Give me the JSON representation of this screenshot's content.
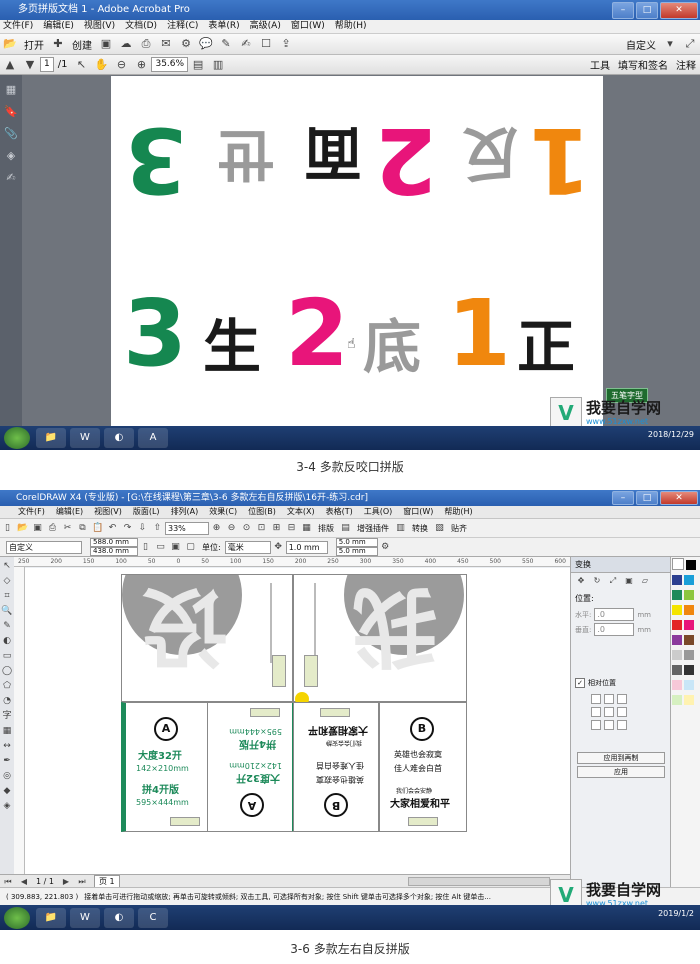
{
  "acrobat": {
    "title": "多页拼版文档 1 - Adobe Acrobat Pro",
    "menu": [
      "文件(F)",
      "编辑(E)",
      "视图(V)",
      "文档(D)",
      "注释(C)",
      "表单(R)",
      "高级(A)",
      "窗口(W)",
      "帮助(H)"
    ],
    "toolbar": {
      "open_label": "打开",
      "create_label": "创建",
      "custom_label": "自定义"
    },
    "nav": {
      "page_current": "1",
      "page_total": "/1",
      "zoom": "35.6%"
    },
    "panels": {
      "tools": "工具",
      "fill_sign": "填写和签名",
      "comment": "注释"
    },
    "page": {
      "top_row": [
        {
          "num": "3",
          "char": "世",
          "num_color": "#158750",
          "char_color": "#9a9a9a"
        },
        {
          "num": "2",
          "char": "面",
          "num_color": "#e8157a",
          "char_color": "#1a1a1a"
        },
        {
          "num": "1",
          "char": "反",
          "num_color": "#f0870e",
          "char_color": "#9a9a9a"
        }
      ],
      "bottom_row": [
        {
          "num": "3",
          "char": "生",
          "num_color": "#158750",
          "char_color": "#1a1a1a"
        },
        {
          "num": "2",
          "char": "底",
          "num_color": "#e8157a",
          "char_color": "#9a9a9a"
        },
        {
          "num": "1",
          "char": "正",
          "num_color": "#f0870e",
          "char_color": "#1a1a1a"
        }
      ]
    },
    "ime": "五笔字型",
    "clock": "2018/12/29"
  },
  "logo": {
    "text": "我要自学网",
    "url": "www.51zxw.net"
  },
  "captions": {
    "first": "3-4 多款反咬口拼版",
    "second": "3-6 多款左右自反拼版"
  },
  "corel": {
    "title": "CorelDRAW X4 (专业版) - [G:\\在线课程\\第三章\\3-6 多款左右自反拼版\\16开-练习.cdr]",
    "menu": [
      "文件(F)",
      "编辑(E)",
      "视图(V)",
      "版面(L)",
      "排列(A)",
      "效果(C)",
      "位图(B)",
      "文本(X)",
      "表格(T)",
      "工具(O)",
      "窗口(W)",
      "帮助(H)"
    ],
    "toolbar": {
      "zoom": "33%",
      "paiban": "排版",
      "plugin": "增强插件",
      "convert": "转换",
      "paste": "贴齐"
    },
    "property": {
      "preset": "自定义",
      "width": "588.0 mm",
      "height": "438.0 mm",
      "unit_label": "单位:",
      "unit": "毫米",
      "nudge": "1.0 mm",
      "dup_x": "5.0 mm",
      "dup_y": "5.0 mm"
    },
    "ruler": [
      "250",
      "200",
      "150",
      "100",
      "50",
      "0",
      "50",
      "100",
      "150",
      "200",
      "250",
      "300",
      "350",
      "400",
      "450",
      "500",
      "550",
      "600"
    ],
    "canvas": {
      "ghost1": "设",
      "ghost2": "我",
      "circle_a": "A",
      "circle_b": "B",
      "size_32": "大度32开",
      "size_32_dim": "142×210mm",
      "size_4": "拼4开版",
      "size_4_dim": "595×444mm",
      "motto1": "英雄也会寂寞",
      "motto2": "佳人难会白首",
      "motto3": "我们会会安静",
      "motto4": "大家相爱和平"
    },
    "docker": {
      "title": "变换",
      "position": "位置:",
      "h_label": "水平:",
      "v_label": "垂直:",
      "h_value": ".0",
      "v_value": ".0",
      "unit": "mm",
      "relative": "相对位置",
      "apply_copy": "应用到再制",
      "apply": "应用"
    },
    "pages": {
      "nav": "1 / 1",
      "tab": "页 1"
    },
    "status": {
      "coords": "( 309.883, 221.803 )",
      "hint": "接着单击可进行拖动或缩放; 再单击可旋转或倾斜; 双击工具, 可选择所有对象; 按住 Shift 键单击可选择多个对象; 按住 Alt 键单击..."
    },
    "clock": "2019/1/2"
  },
  "colors": {
    "green": "#158750",
    "pink": "#e8157a",
    "orange": "#f0870e",
    "grey": "#9a9a9a",
    "black": "#1a1a1a"
  }
}
